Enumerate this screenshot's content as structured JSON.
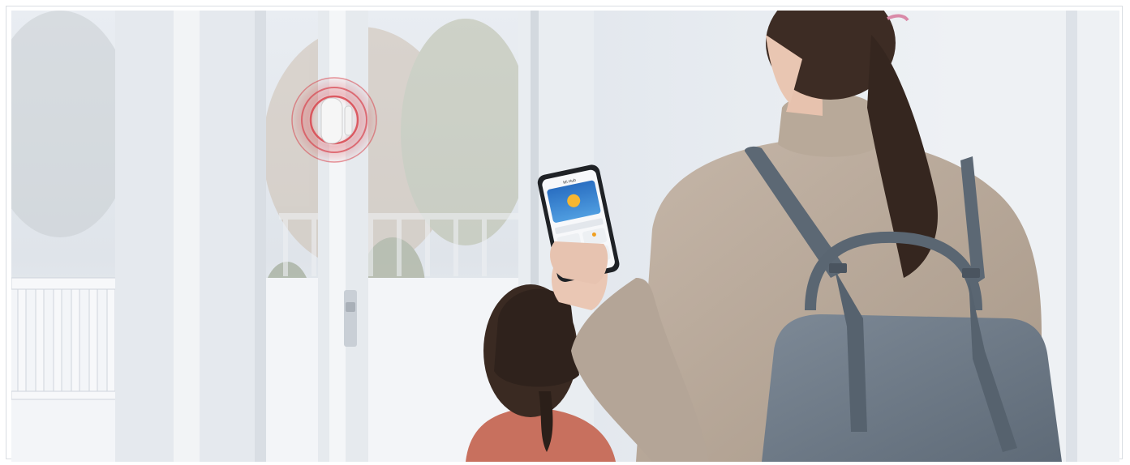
{
  "scene": {
    "description_items": [
      "door-sensor",
      "smartphone",
      "woman",
      "child",
      "backpack",
      "glass-door",
      "snowy-yard"
    ],
    "colors": {
      "alert_ring": "#d8454e",
      "sensor_body": "#f4f4f4",
      "sweater": "#b9aa9c",
      "bag": "#6f7c89",
      "child_top": "#c8705e",
      "hair": "#3a2a22",
      "snow": "#f3f5f8",
      "frame_white": "#e7ebef"
    }
  },
  "phone": {
    "app_title": "Mi Hub",
    "screen_items": [
      "weather-card",
      "status-row",
      "device-tiles"
    ]
  }
}
